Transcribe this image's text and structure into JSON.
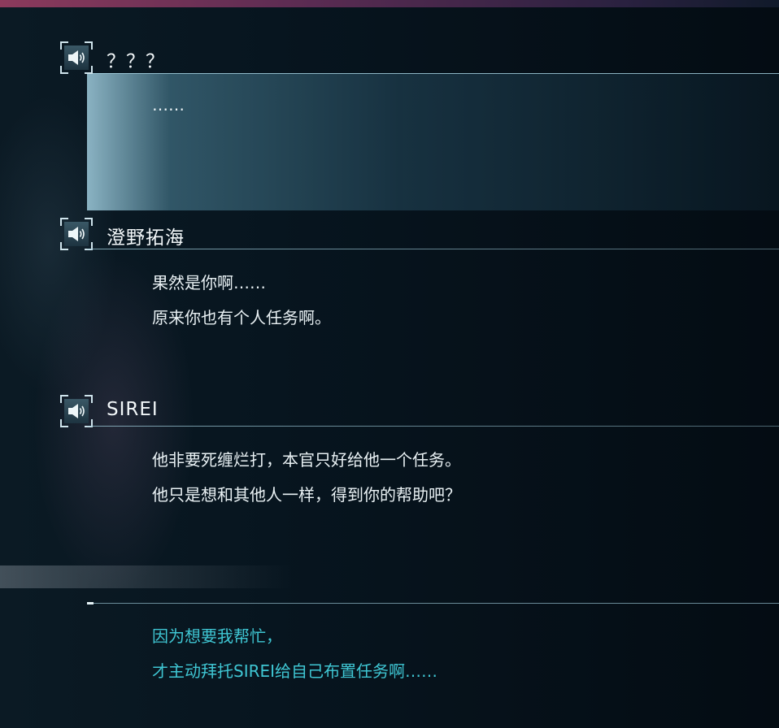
{
  "log": [
    {
      "speaker": "？？？",
      "lines": [
        "……"
      ],
      "highlighted": true
    },
    {
      "speaker": "澄野拓海",
      "lines": [
        "果然是你啊……",
        "原来你也有个人任务啊。"
      ],
      "highlighted": false
    },
    {
      "speaker": "SIREI",
      "lines": [
        "他非要死缠烂打，本官只好给他一个任务。",
        "他只是想和其他人一样，得到你的帮助吧？"
      ],
      "highlighted": false
    }
  ],
  "choice": {
    "lines": [
      "因为想要我帮忙，",
      "才主动拜托SIREI给自己布置任务啊……"
    ],
    "color": "#3fc6d3"
  },
  "icons": {
    "voice": "speaker-volume-icon"
  },
  "colors": {
    "top_bar": "#8c3a5c",
    "highlight": "#a0cdde",
    "choice_text": "#3fc6d3"
  }
}
